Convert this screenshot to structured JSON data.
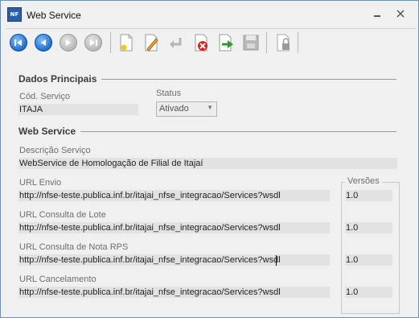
{
  "window": {
    "title": "Web Service",
    "app_icon_text": "NF"
  },
  "toolbar": {
    "buttons": [
      {
        "name": "first-record",
        "icon": "skip-first-icon",
        "enabled": true
      },
      {
        "name": "previous-record",
        "icon": "previous-icon",
        "enabled": true
      },
      {
        "name": "next-record",
        "icon": "next-icon",
        "enabled": false
      },
      {
        "name": "last-record",
        "icon": "skip-last-icon",
        "enabled": false
      },
      {
        "name": "new",
        "icon": "new-document-icon",
        "enabled": true
      },
      {
        "name": "edit",
        "icon": "pencil-icon",
        "enabled": true
      },
      {
        "name": "undo",
        "icon": "undo-icon",
        "enabled": false
      },
      {
        "name": "delete",
        "icon": "delete-icon",
        "enabled": true
      },
      {
        "name": "export",
        "icon": "export-arrow-icon",
        "enabled": true
      },
      {
        "name": "save",
        "icon": "floppy-disk-icon",
        "enabled": false
      },
      {
        "name": "lock",
        "icon": "lock-icon",
        "enabled": false
      }
    ]
  },
  "dados_principais": {
    "title": "Dados Principais",
    "cod_servico_label": "Cód. Serviço",
    "cod_servico_value": "ITAJA",
    "status_label": "Status",
    "status_value": "Ativado"
  },
  "web_service": {
    "title": "Web Service",
    "descricao_label": "Descrição Serviço",
    "descricao_value": "WebService de Homologação de Filial de Itajaí",
    "versoes_label": "Versões",
    "urls": [
      {
        "label": "URL Envio",
        "value": "http://nfse-teste.publica.inf.br/itajai_nfse_integracao/Services?wsdl",
        "version": "1.0"
      },
      {
        "label": "URL Consulta de Lote",
        "value": "http://nfse-teste.publica.inf.br/itajai_nfse_integracao/Services?wsdl",
        "version": "1.0"
      },
      {
        "label": "URL Consulta de Nota RPS",
        "value": "http://nfse-teste.publica.inf.br/itajai_nfse_integracao/Services?wsdl",
        "version": "1.0"
      },
      {
        "label": "URL Cancelamento",
        "value": "http://nfse-teste.publica.inf.br/itajai_nfse_integracao/Services?wsdl",
        "version": "1.0"
      }
    ]
  },
  "colors": {
    "nav_active": "#1f6fd1",
    "field_bg": "#e2e2e2",
    "label_gray": "#6e6e6e"
  }
}
